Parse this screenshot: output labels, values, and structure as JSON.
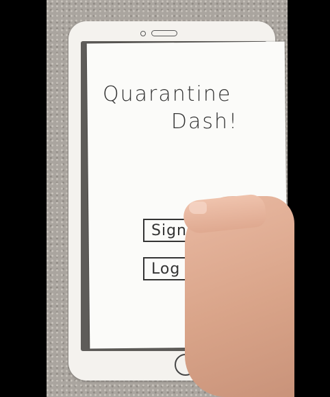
{
  "app": {
    "title_line1": "Quarantine",
    "title_line2": "Dash!"
  },
  "buttons": {
    "signup_label": "Sign up",
    "login_label": "Log in"
  },
  "colors": {
    "paper": "#fbfbf9",
    "ink": "#333333",
    "carpet": "#aaa59f"
  }
}
